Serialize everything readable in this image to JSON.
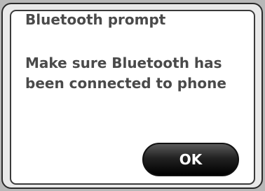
{
  "dialog": {
    "title": "Bluetooth prompt",
    "message_lines": [
      "Make sure Bluetooth has",
      "been connected to phone"
    ],
    "ok_label": "OK"
  },
  "colors": {
    "text": "#4a4a4a",
    "button": "#111111",
    "button_text": "#ffffff"
  }
}
